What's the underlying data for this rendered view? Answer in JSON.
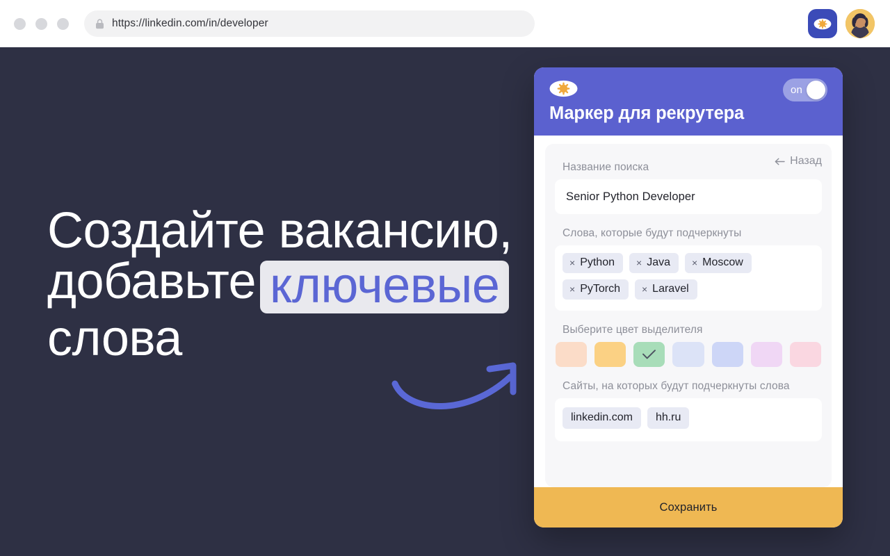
{
  "browser": {
    "url": "https://linkedin.com/in/developer",
    "lock_icon": "lock-icon",
    "extension_icon": "eye-icon",
    "avatar_icon": "user-avatar"
  },
  "hero": {
    "line1": "Создайте вакансию,",
    "line2_prefix": "добавьте",
    "line2_highlight": "ключевые",
    "line3": "слова",
    "highlight_bg": "#e9e9ee",
    "highlight_color": "#5b66d4",
    "background": "#2e3044",
    "arrow_color": "#5a68d6"
  },
  "panel": {
    "title": "Маркер для рекрутера",
    "header_color": "#5b61cf",
    "logo_icon": "eye-icon",
    "toggle": {
      "label": "on",
      "state": "on"
    },
    "back_link": {
      "label": "Назад",
      "icon": "arrow-left-icon"
    },
    "search_name": {
      "label": "Название поиска",
      "value": "Senior Python Developer",
      "placeholder": "Название поиска"
    },
    "keywords": {
      "label": "Слова, которые будут подчеркнуты",
      "remove_symbol": "×",
      "tags": [
        "Python",
        "Java",
        "Moscow",
        "PyTorch",
        "Laravel"
      ]
    },
    "highlighter_color": {
      "label": "Выберите цвет выделителя",
      "selected_index": 2,
      "check_icon": "check-icon",
      "swatches": [
        {
          "name": "peach",
          "hex": "#fbdcc8"
        },
        {
          "name": "yellow",
          "hex": "#fbd184"
        },
        {
          "name": "green",
          "hex": "#a8ddb9"
        },
        {
          "name": "light-blue",
          "hex": "#dce3f7"
        },
        {
          "name": "periwinkle",
          "hex": "#cdd6f7"
        },
        {
          "name": "lilac",
          "hex": "#f0d7f5"
        },
        {
          "name": "pink",
          "hex": "#fad7e1"
        }
      ]
    },
    "sites": {
      "label": "Сайты, на которых будут подчеркнуты слова",
      "tags": [
        "linkedin.com",
        "hh.ru"
      ]
    },
    "save": {
      "label": "Сохранить",
      "color": "#efb853"
    }
  }
}
